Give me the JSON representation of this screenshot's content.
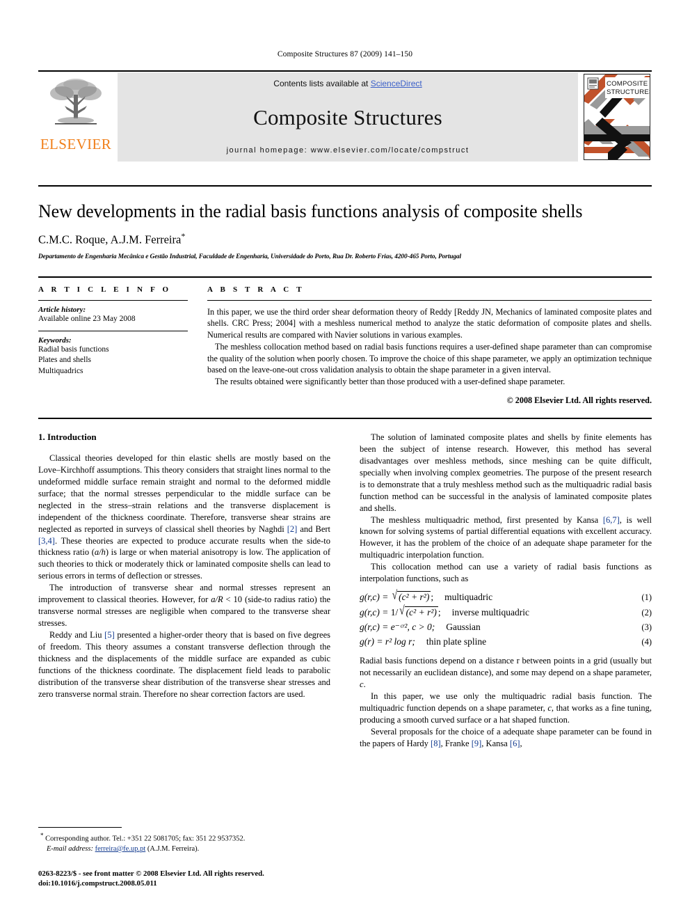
{
  "running_head": "Composite Structures 87 (2009) 141–150",
  "masthead": {
    "publisher_name": "ELSEVIER",
    "contents_text": "Contents lists available at ",
    "sciencedirect_label": "ScienceDirect",
    "journal_name": "Composite Structures",
    "homepage_line": "journal homepage: www.elsevier.com/locate/compstruct",
    "cover_title_line1": "COMPOSITE",
    "cover_title_line2": "STRUCTURES",
    "link_color": "#3a5fc8",
    "elsevier_orange": "#F07F1A",
    "banner_bg": "#e4e4e4"
  },
  "article": {
    "title": "New developments in the radial basis functions analysis of composite shells",
    "authors": "C.M.C. Roque, A.J.M. Ferreira",
    "corresponding_marker": "*",
    "affiliation": "Departamento de Engenharia Mecânica e Gestão Industrial, Faculdade de Engenharia, Universidade do Porto, Rua Dr. Roberto Frias, 4200-465 Porto, Portugal"
  },
  "article_info": {
    "heading": "A R T I C L E   I N F O",
    "history_label": "Article history:",
    "history_value": "Available online 23 May 2008",
    "keywords_label": "Keywords:",
    "keywords": [
      "Radial basis functions",
      "Plates and shells",
      "Multiquadrics"
    ]
  },
  "abstract": {
    "heading": "A B S T R A C T",
    "paragraphs": [
      "In this paper, we use the third order shear deformation theory of Reddy [Reddy JN, Mechanics of laminated composite plates and shells. CRC Press; 2004] with a meshless numerical method to analyze the static deformation of composite plates and shells. Numerical results are compared with Navier solutions in various examples.",
      "The meshless collocation method based on radial basis functions requires a user-defined shape parameter than can compromise the quality of the solution when poorly chosen. To improve the choice of this shape parameter, we apply an optimization technique based on the leave-one-out cross validation analysis to obtain the shape parameter in a given interval.",
      "The results obtained were significantly better than those produced with a user-defined shape parameter."
    ],
    "copyright": "© 2008 Elsevier Ltd. All rights reserved."
  },
  "body": {
    "section_title": "1. Introduction",
    "left_paragraphs": [
      {
        "segments": [
          {
            "t": "Classical theories developed for thin elastic shells are mostly based on the Love–Kirchhoff assumptions. This theory considers that straight lines normal to the undeformed middle surface remain straight and normal to the deformed middle surface; that the normal stresses perpendicular to the middle surface can be neglected in the stress–strain relations and the transverse displacement is independent of the thickness coordinate. Therefore, transverse shear strains are neglected as reported in surveys of classical shell theories by Naghdi "
          },
          {
            "t": "[2]",
            "style": "ref"
          },
          {
            "t": " and Bert "
          },
          {
            "t": "[3,4]",
            "style": "ref"
          },
          {
            "t": ". These theories are expected to produce accurate results when the side-to thickness ratio ("
          },
          {
            "t": "a/h",
            "style": "it"
          },
          {
            "t": ") is large or when material anisotropy is low. The application of such theories to thick or moderately thick or laminated composite shells can lead to serious errors in terms of deflection or stresses."
          }
        ]
      },
      {
        "segments": [
          {
            "t": "The introduction of transverse shear and normal stresses represent an improvement to classical theories. However, for "
          },
          {
            "t": "a/R",
            "style": "it"
          },
          {
            "t": " < 10 (side-to radius ratio) the transverse normal stresses are negligible when compared to the transverse shear stresses."
          }
        ]
      },
      {
        "segments": [
          {
            "t": "Reddy and Liu "
          },
          {
            "t": "[5]",
            "style": "ref"
          },
          {
            "t": " presented a higher-order theory that is based on five degrees of freedom. This theory assumes a constant transverse deflection through the thickness and the displacements of the middle surface are expanded as cubic functions of the thickness coordinate. The displacement field leads to parabolic distribution of the transverse shear distribution of the transverse shear stresses and zero transverse normal strain. Therefore no shear correction factors are used."
          }
        ]
      }
    ],
    "right_paragraphs_top": [
      {
        "segments": [
          {
            "t": "The solution of laminated composite plates and shells by finite elements has been the subject of intense research. However, this method has several disadvantages over meshless methods, since meshing can be quite difficult, specially when involving complex geometries. The purpose of the present research is to demonstrate that a truly meshless method such as the multiquadric radial basis function method can be successful in the analysis of laminated composite plates and shells."
          }
        ]
      },
      {
        "segments": [
          {
            "t": "The meshless multiquadric method, first presented by Kansa "
          },
          {
            "t": "[6,7]",
            "style": "ref"
          },
          {
            "t": ", is well known for solving systems of partial differential equations with excellent accuracy. However, it has the problem of the choice of an adequate shape parameter for the multiquadric interpolation function."
          }
        ]
      },
      {
        "segments": [
          {
            "t": "This collocation method can use a variety of radial basis functions as interpolation functions, such as"
          }
        ]
      }
    ],
    "right_paragraphs_bottom": [
      {
        "segments": [
          {
            "t": "Radial basis functions depend on a distance r between points in a grid (usually but not necessarily an euclidean distance), and some may depend on a shape parameter, "
          },
          {
            "t": "c",
            "style": "it"
          },
          {
            "t": "."
          }
        ],
        "indent": false
      },
      {
        "segments": [
          {
            "t": "In this paper, we use only the multiquadric radial basis function. The multiquadric function depends on a shape parameter, "
          },
          {
            "t": "c",
            "style": "it"
          },
          {
            "t": ", that works as a fine tuning, producing a smooth curved surface or a hat shaped function."
          }
        ],
        "indent": true
      },
      {
        "segments": [
          {
            "t": "Several proposals for the choice of a adequate shape parameter can be found in the papers of Hardy "
          },
          {
            "t": "[8]",
            "style": "ref"
          },
          {
            "t": ", Franke "
          },
          {
            "t": "[9]",
            "style": "ref"
          },
          {
            "t": ", Kansa "
          },
          {
            "t": "[6]",
            "style": "ref"
          },
          {
            "t": ","
          }
        ],
        "indent": true
      }
    ],
    "equations": [
      {
        "lhs": "g(r,c) = ",
        "kind": "sqrt",
        "radicand": "(c² + r²)",
        "prefix": "",
        "tail": ";",
        "label": "multiquadric",
        "number": "(1)"
      },
      {
        "lhs": "g(r,c) = ",
        "kind": "sqrt",
        "radicand": "(c² + r²)",
        "prefix": "1/",
        "tail": ";",
        "label": "inverse multiquadric",
        "number": "(2)"
      },
      {
        "lhs": "g(r,c) = ",
        "kind": "plain",
        "expr": "e⁻ᶜʳ²,  c > 0;",
        "label": "Gaussian",
        "number": "(3)"
      },
      {
        "lhs": "g(r) = ",
        "kind": "plain",
        "expr": "r² log r;",
        "label": "thin plate spline",
        "number": "(4)"
      }
    ]
  },
  "footnotes": {
    "corresponding": "Corresponding author. Tel.: +351 22 5081705; fax: 351 22 9537352.",
    "email_label": "E-mail address:",
    "email": "ferreira@fe.up.pt",
    "email_suffix": "(A.J.M. Ferreira).",
    "issn_line1": "0263-8223/$ - see front matter © 2008 Elsevier Ltd. All rights reserved.",
    "issn_line2": "doi:10.1016/j.compstruct.2008.05.011"
  }
}
